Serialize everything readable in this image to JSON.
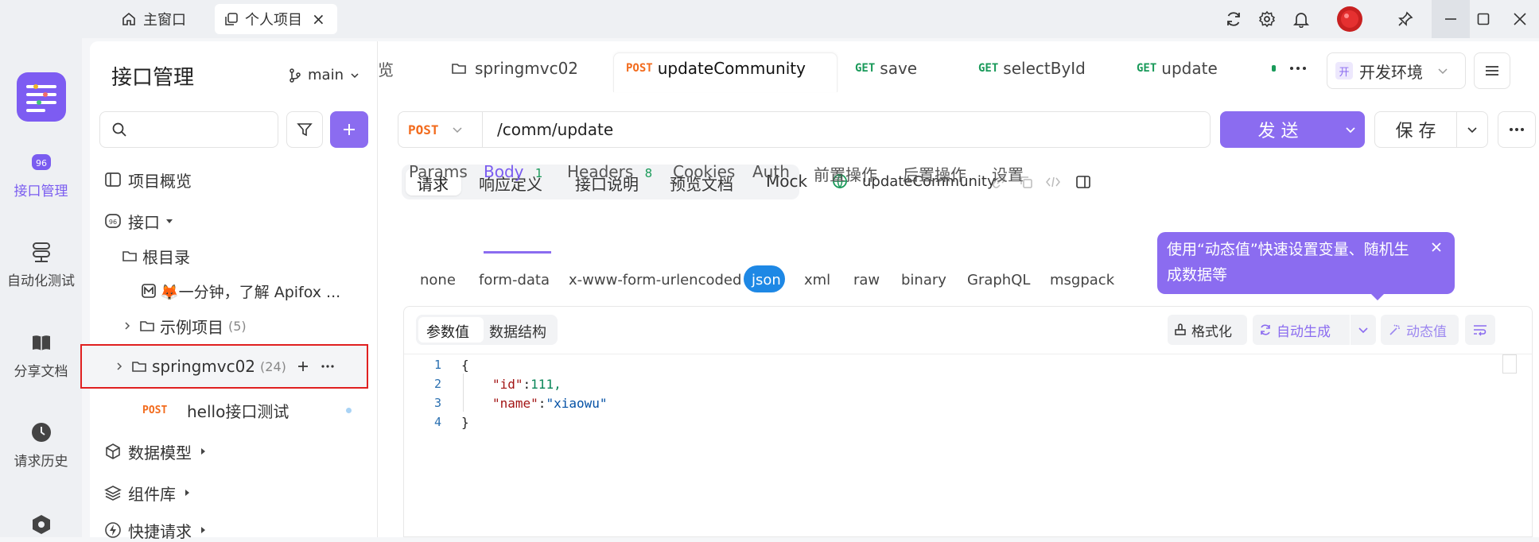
{
  "titlebar": {
    "home_tab": "主窗口",
    "project_tab": "个人项目",
    "close_glyph": "×"
  },
  "rail": {
    "items": [
      {
        "label": "接口管理",
        "icon": "api-icon",
        "active": true
      },
      {
        "label": "自动化测试",
        "icon": "automation-icon"
      },
      {
        "label": "分享文档",
        "icon": "book-icon"
      },
      {
        "label": "请求历史",
        "icon": "clock-icon"
      }
    ]
  },
  "sidebar": {
    "title": "接口管理",
    "branch": "main",
    "search_placeholder": "",
    "tree": {
      "overview": "项目概览",
      "apis": "接口",
      "root": "根目录",
      "intro": "🦊一分钟，了解 Apifox ...",
      "example": "示例项目",
      "example_count": "(5)",
      "springmvc": "springmvc02",
      "springmvc_count": "(24)",
      "hello_method": "POST",
      "hello": "hello接口测试",
      "models": "数据模型",
      "components": "组件库",
      "quick": "快捷请求"
    }
  },
  "tabs": {
    "partial": "览",
    "items": [
      {
        "method": "",
        "label": "springmvc02"
      },
      {
        "method": "POST",
        "label": "updateCommunity"
      },
      {
        "method": "GET",
        "label": "save"
      },
      {
        "method": "GET",
        "label": "selectById"
      },
      {
        "method": "GET",
        "label": "update"
      }
    ],
    "env_badge": "开",
    "env": "开发环境"
  },
  "request": {
    "method": "POST",
    "url": "/comm/update",
    "send": "发 送",
    "save": "保 存"
  },
  "mode_tabs": [
    "请求",
    "响应定义",
    "接口说明",
    "预览文档",
    "Mock"
  ],
  "api_name": "updateCommunity",
  "param_tabs": {
    "params": "Params",
    "body": "Body",
    "body_count": "1",
    "headers": "Headers",
    "headers_count": "8",
    "cookies": "Cookies",
    "auth": "Auth",
    "pre": "前置操作",
    "post": "后置操作",
    "settings": "设置"
  },
  "body_types": [
    "none",
    "form-data",
    "x-www-form-urlencoded",
    "json",
    "xml",
    "raw",
    "binary",
    "GraphQL",
    "msgpack"
  ],
  "tooltip": {
    "text": "使用“动态值”快速设置变量、随机生成数据等"
  },
  "editor": {
    "tab_values": "参数值",
    "tab_schema": "数据结构",
    "format": "格式化",
    "autogen": "自动生成",
    "dynamic": "动态值",
    "line_numbers": [
      "1",
      "2",
      "3",
      "4"
    ],
    "brace_open": "{",
    "key_id": "\"id\"",
    "val_id": "111,",
    "key_name": "\"name\"",
    "val_name": "\"xiaowu\"",
    "brace_close": "}",
    "colon": ":"
  },
  "colors": {
    "accent": "#8b6cf0",
    "get": "#1a9a5a",
    "post": "#f26b1d",
    "highlight_box": "#e02020"
  }
}
